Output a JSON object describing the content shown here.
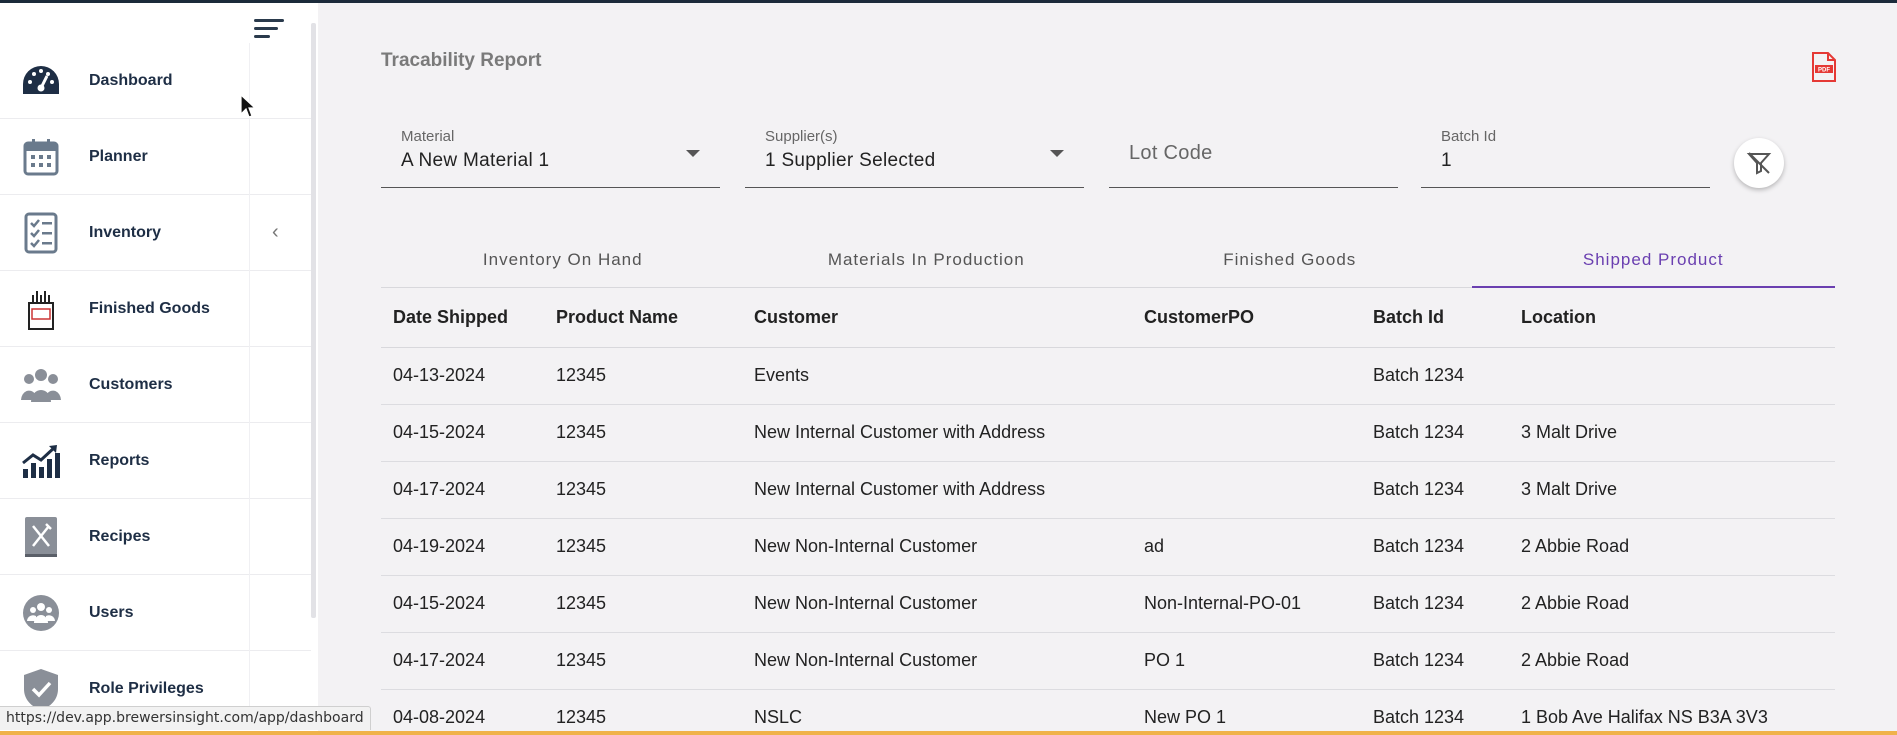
{
  "sidebar": {
    "items": [
      {
        "label": "Dashboard",
        "icon": "dashboard-gauge-icon"
      },
      {
        "label": "Planner",
        "icon": "calendar-icon"
      },
      {
        "label": "Inventory",
        "icon": "checklist-icon"
      },
      {
        "label": "Finished Goods",
        "icon": "bottles-icon"
      },
      {
        "label": "Customers",
        "icon": "people-group-icon"
      },
      {
        "label": "Reports",
        "icon": "trend-chart-icon"
      },
      {
        "label": "Recipes",
        "icon": "fork-knife-icon"
      },
      {
        "label": "Users",
        "icon": "users-icon"
      },
      {
        "label": "Role Privileges",
        "icon": "shield-check-icon"
      }
    ]
  },
  "statusbar": {
    "url": "https://dev.app.brewersinsight.com/app/dashboard"
  },
  "page": {
    "title": "Tracability Report"
  },
  "filters": {
    "material": {
      "label": "Material",
      "value": "A New Material 1"
    },
    "suppliers": {
      "label": "Supplier(s)",
      "value": "1 Supplier Selected"
    },
    "lot_code": {
      "placeholder": "Lot Code"
    },
    "batch_id": {
      "label": "Batch Id",
      "value": "1"
    }
  },
  "tabs": [
    {
      "label": "Inventory On Hand",
      "active": false
    },
    {
      "label": "Materials In Production",
      "active": false
    },
    {
      "label": "Finished Goods",
      "active": false
    },
    {
      "label": "Shipped Product",
      "active": true
    }
  ],
  "table": {
    "columns": [
      "Date Shipped",
      "Product Name",
      "Customer",
      "CustomerPO",
      "Batch Id",
      "Location"
    ],
    "rows": [
      [
        "04-13-2024",
        "12345",
        "Events",
        "",
        "Batch 1234",
        ""
      ],
      [
        "04-15-2024",
        "12345",
        "New Internal Customer with Address",
        "",
        "Batch 1234",
        "3 Malt Drive"
      ],
      [
        "04-17-2024",
        "12345",
        "New Internal Customer with Address",
        "",
        "Batch 1234",
        "3 Malt Drive"
      ],
      [
        "04-19-2024",
        "12345",
        "New Non-Internal Customer",
        "ad",
        "Batch 1234",
        "2 Abbie Road"
      ],
      [
        "04-15-2024",
        "12345",
        "New Non-Internal Customer",
        "Non-Internal-PO-01",
        "Batch 1234",
        "2 Abbie Road"
      ],
      [
        "04-17-2024",
        "12345",
        "New Non-Internal Customer",
        "PO 1",
        "Batch 1234",
        "2 Abbie Road"
      ],
      [
        "04-08-2024",
        "12345",
        "NSLC",
        "New PO 1",
        "Batch 1234",
        "1 Bob Ave Halifax NS B3A 3V3"
      ]
    ]
  },
  "colors": {
    "accent": "#6a3fb0",
    "nav_text": "#1e2e45",
    "pdf": "#e53935"
  }
}
